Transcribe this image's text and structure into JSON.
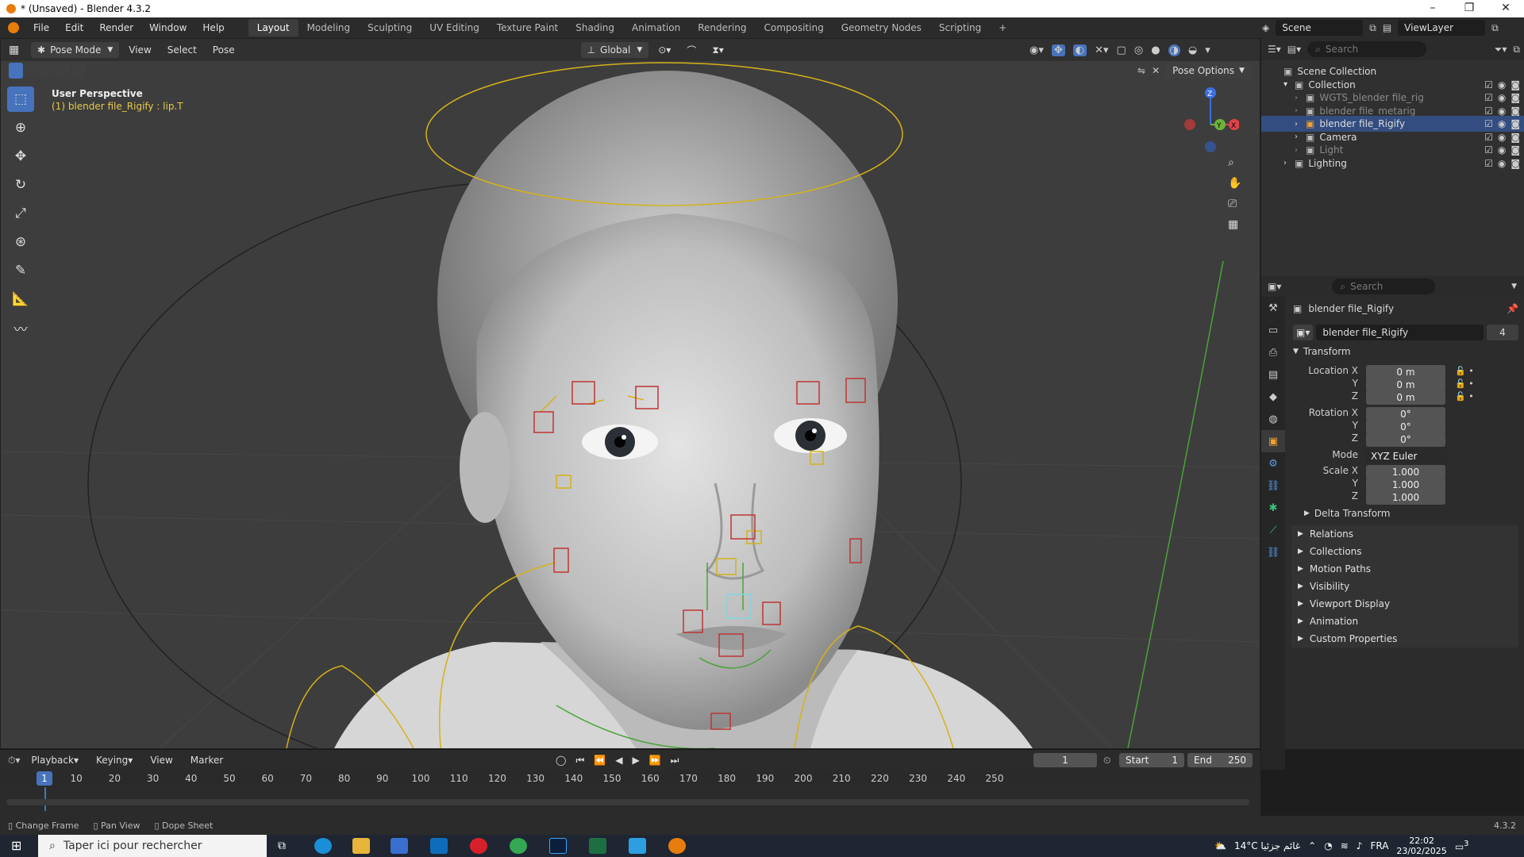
{
  "window": {
    "title": "* (Unsaved) - Blender 4.3.2",
    "controls": [
      "–",
      "❐",
      "✕"
    ]
  },
  "menu": [
    "File",
    "Edit",
    "Render",
    "Window",
    "Help"
  ],
  "workspaces": [
    "Layout",
    "Modeling",
    "Sculpting",
    "UV Editing",
    "Texture Paint",
    "Shading",
    "Animation",
    "Rendering",
    "Compositing",
    "Geometry Nodes",
    "Scripting",
    "+"
  ],
  "scene": {
    "label": "Scene",
    "viewlayer": "ViewLayer"
  },
  "viewport": {
    "mode": "Pose Mode",
    "menus": [
      "View",
      "Select",
      "Pose"
    ],
    "orientation": "Global",
    "pose_options": "Pose Options",
    "perspective": "User Perspective",
    "active": "(1) blender file_Rigify : lip.T",
    "gizmo": {
      "z": "Z",
      "x": "X",
      "y": "Y"
    }
  },
  "tools": [
    "select-box-icon",
    "cursor-icon",
    "move-icon",
    "rotate-icon",
    "scale-icon",
    "transform-icon",
    "annotate-icon",
    "measure-icon",
    "relax-icon"
  ],
  "outliner": {
    "search": "Search",
    "rows": [
      {
        "label": "Scene Collection",
        "indent": 0,
        "muted": false,
        "sel": false
      },
      {
        "label": "Collection",
        "indent": 1,
        "muted": false,
        "sel": false
      },
      {
        "label": "WGTS_blender file_rig",
        "indent": 2,
        "muted": true,
        "sel": false
      },
      {
        "label": "blender file_metarig",
        "indent": 2,
        "muted": true,
        "sel": false
      },
      {
        "label": "blender file_Rigify",
        "indent": 2,
        "muted": false,
        "sel": true
      },
      {
        "label": "Camera",
        "indent": 2,
        "muted": false,
        "sel": false
      },
      {
        "label": "Light",
        "indent": 2,
        "muted": true,
        "sel": false
      },
      {
        "label": "Lighting",
        "indent": 1,
        "muted": false,
        "sel": false
      }
    ]
  },
  "properties": {
    "search": "Search",
    "object": "blender file_Rigify",
    "datablock": "blender file_Rigify",
    "users": "4",
    "transform": {
      "title": "Transform",
      "location": {
        "label": "Location X",
        "x": "0 m",
        "y": "0 m",
        "z": "0 m"
      },
      "rotation": {
        "label": "Rotation X",
        "x": "0°",
        "y": "0°",
        "z": "0°"
      },
      "mode": {
        "label": "Mode",
        "value": "XYZ Euler"
      },
      "scale": {
        "label": "Scale X",
        "x": "1.000",
        "y": "1.000",
        "z": "1.000"
      },
      "axis": {
        "y": "Y",
        "z": "Z"
      }
    },
    "delta": "Delta Transform",
    "sections": [
      "Relations",
      "Collections",
      "Motion Paths",
      "Visibility",
      "Viewport Display",
      "Animation",
      "Custom Properties"
    ]
  },
  "timeline": {
    "menus": [
      "Playback",
      "Keying",
      "View",
      "Marker"
    ],
    "current": "1",
    "start_label": "Start",
    "start": "1",
    "end_label": "End",
    "end": "250",
    "ticks": [
      "10",
      "20",
      "30",
      "40",
      "50",
      "60",
      "70",
      "80",
      "90",
      "100",
      "110",
      "120",
      "130",
      "140",
      "150",
      "160",
      "170",
      "180",
      "190",
      "200",
      "210",
      "220",
      "230",
      "240",
      "250"
    ],
    "playhead": "1"
  },
  "status": {
    "items": [
      "Change Frame",
      "Pan View",
      "Dope Sheet"
    ],
    "version": "4.3.2"
  },
  "taskbar": {
    "search": "Taper ici pour rechercher",
    "weather": "14°C غائم جزئيا",
    "lang": "FRA",
    "time": "22:02",
    "date": "23/02/2025",
    "notif": "3"
  }
}
